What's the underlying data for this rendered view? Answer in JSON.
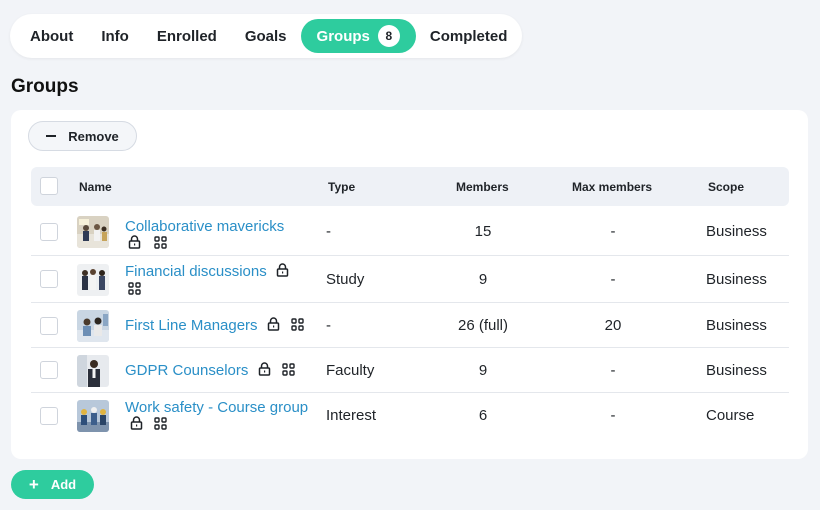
{
  "tabs": [
    {
      "label": "About"
    },
    {
      "label": "Info"
    },
    {
      "label": "Enrolled"
    },
    {
      "label": "Goals"
    },
    {
      "label": "Groups",
      "badge": "8",
      "active": true
    },
    {
      "label": "Completed"
    }
  ],
  "page_title": "Groups",
  "toolbar": {
    "remove_label": "Remove",
    "add_label": "Add"
  },
  "table": {
    "headers": {
      "name": "Name",
      "type": "Type",
      "members": "Members",
      "max_members": "Max members",
      "scope": "Scope"
    },
    "rows": [
      {
        "name": "Collaborative mavericks",
        "type": "-",
        "members": "15",
        "max_members": "-",
        "scope": "Business"
      },
      {
        "name": "Financial discussions",
        "type": "Study",
        "members": "9",
        "max_members": "-",
        "scope": "Business"
      },
      {
        "name": "First Line Managers",
        "type": "-",
        "members": "26 (full)",
        "max_members": "20",
        "scope": "Business"
      },
      {
        "name": "GDPR Counselors",
        "type": "Faculty",
        "members": "9",
        "max_members": "-",
        "scope": "Business"
      },
      {
        "name": "Work safety - Course group",
        "type": "Interest",
        "members": "6",
        "max_members": "-",
        "scope": "Course"
      }
    ]
  },
  "colors": {
    "accent": "#2ecc9e",
    "link": "#2a8fc7",
    "background": "#f2f4f8"
  },
  "icons": {
    "lock": "lock-icon",
    "grid": "grid-icon",
    "minus": "minus-icon",
    "plus": "plus-icon"
  }
}
